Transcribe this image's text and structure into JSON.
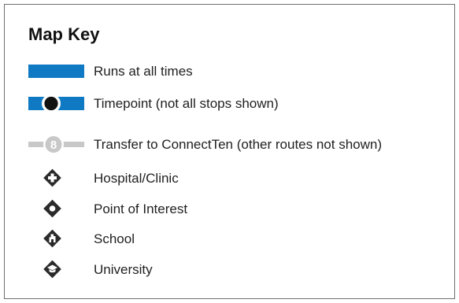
{
  "title": "Map Key",
  "colors": {
    "route_blue": "#0f7ac3",
    "transfer_gray": "#c8c8c8",
    "icon_dark": "#2b2b2b",
    "border": "#6f6f6f"
  },
  "items": [
    {
      "symbol": "route-line",
      "label": "Runs at all times"
    },
    {
      "symbol": "timepoint",
      "label": "Timepoint (not all stops shown)"
    },
    {
      "symbol": "transfer-badge",
      "badge_number": "8",
      "label": "Transfer to ConnectTen (other routes not shown)"
    },
    {
      "symbol": "hospital-icon",
      "label": "Hospital/Clinic"
    },
    {
      "symbol": "point-of-interest-icon",
      "label": "Point of Interest"
    },
    {
      "symbol": "school-icon",
      "label": "School"
    },
    {
      "symbol": "university-icon",
      "label": "University"
    }
  ]
}
